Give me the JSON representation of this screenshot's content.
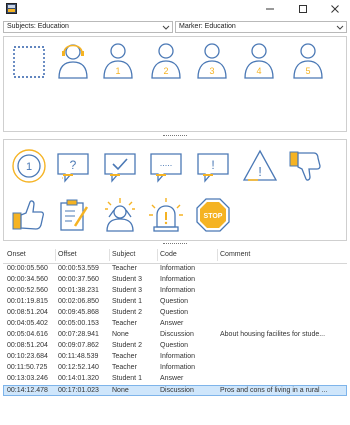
{
  "window": {
    "title": ""
  },
  "toolbar": {
    "subjects_combo": "Subjects: Education",
    "marker_combo": "Marker: Education"
  },
  "subjects": [
    {
      "name": "Empty"
    },
    {
      "name": "Teacher"
    },
    {
      "name": "Student",
      "label": "1"
    },
    {
      "name": "Student",
      "label": "2"
    },
    {
      "name": "Student",
      "label": "3"
    },
    {
      "name": "Student",
      "label": "4"
    },
    {
      "name": "Student",
      "label": "5"
    }
  ],
  "markers": [
    {
      "name": "Information",
      "label": "1"
    },
    {
      "name": "Question",
      "label": "?"
    },
    {
      "name": "Answer"
    },
    {
      "name": "Discussion",
      "label": "....."
    },
    {
      "name": "Exclamation",
      "label": "!"
    },
    {
      "name": "Warning",
      "label": "!"
    },
    {
      "name": "Thumbs down"
    },
    {
      "name": "Thumbs up"
    },
    {
      "name": "Task"
    },
    {
      "name": "Stress"
    },
    {
      "name": "Alarm"
    },
    {
      "name": "Stop",
      "label": "STOP"
    }
  ],
  "grid": {
    "columns": [
      "Onset",
      "Offset",
      "Subject",
      "Code",
      "Comment"
    ],
    "rows": [
      {
        "onset": "00:00:05.560",
        "offset": "00:00:53.559",
        "subject": "Teacher",
        "code": "Information",
        "comment": ""
      },
      {
        "onset": "00:00:34.560",
        "offset": "00:00:37.560",
        "subject": "Student 3",
        "code": "Information",
        "comment": ""
      },
      {
        "onset": "00:00:52.560",
        "offset": "00:01:38.231",
        "subject": "Student 3",
        "code": "Information",
        "comment": ""
      },
      {
        "onset": "00:01:19.815",
        "offset": "00:02:06.850",
        "subject": "Student 1",
        "code": "Question",
        "comment": ""
      },
      {
        "onset": "00:08:51.204",
        "offset": "00:09:45.868",
        "subject": "Student 2",
        "code": "Question",
        "comment": ""
      },
      {
        "onset": "00:04:05.402",
        "offset": "00:05:00.153",
        "subject": "Teacher",
        "code": "Answer",
        "comment": ""
      },
      {
        "onset": "00:05:04.616",
        "offset": "00:07:28.941",
        "subject": "None",
        "code": "Discussion",
        "comment": "About housing facilites for stude..."
      },
      {
        "onset": "00:08:51.204",
        "offset": "00:09:07.862",
        "subject": "Student 2",
        "code": "Question",
        "comment": ""
      },
      {
        "onset": "00:10:23.684",
        "offset": "00:11:48.539",
        "subject": "Teacher",
        "code": "Information",
        "comment": ""
      },
      {
        "onset": "00:11:50.725",
        "offset": "00:12:52.140",
        "subject": "Teacher",
        "code": "Information",
        "comment": ""
      },
      {
        "onset": "00:13:03.246",
        "offset": "00:14:01.320",
        "subject": "Student 1",
        "code": "Answer",
        "comment": ""
      },
      {
        "onset": "00:14:12.478",
        "offset": "00:17:01.023",
        "subject": "None",
        "code": "Discussion",
        "comment": "Pros and cons of living in a rural ..."
      }
    ],
    "selected_index": 11
  },
  "colors": {
    "accent": "#f5b323",
    "stroke": "#4a78b5",
    "selection": "#cfe6fb"
  }
}
